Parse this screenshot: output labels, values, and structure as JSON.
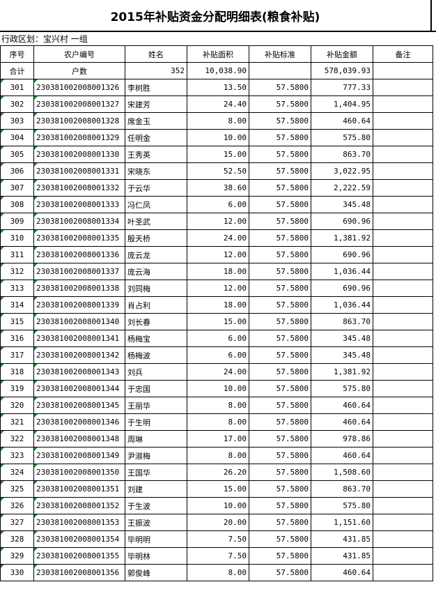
{
  "title": "2015年补贴资金分配明细表(粮食补贴)",
  "region": "行政区划：宝兴村 一组",
  "headers": [
    "序号",
    "农户编号",
    "姓名",
    "补贴面积",
    "补贴标准",
    "补贴金额",
    "备注"
  ],
  "summary": {
    "label": "合计",
    "households_label": "户数",
    "households": "352",
    "area": "10,038.90",
    "standard": "",
    "amount": "578,039.93",
    "note": ""
  },
  "rows": [
    {
      "no": "301",
      "code": "230381002008001326",
      "name": "李树胜",
      "area": "13.50",
      "std": "57.5800",
      "amt": "777.33"
    },
    {
      "no": "302",
      "code": "230381002008001327",
      "name": "宋建芳",
      "area": "24.40",
      "std": "57.5800",
      "amt": "1,404.95"
    },
    {
      "no": "303",
      "code": "230381002008001328",
      "name": "席金玉",
      "area": "8.00",
      "std": "57.5800",
      "amt": "460.64"
    },
    {
      "no": "304",
      "code": "230381002008001329",
      "name": "任明金",
      "area": "10.00",
      "std": "57.5800",
      "amt": "575.80"
    },
    {
      "no": "305",
      "code": "230381002008001330",
      "name": "王秀英",
      "area": "15.00",
      "std": "57.5800",
      "amt": "863.70"
    },
    {
      "no": "306",
      "code": "230381002008001331",
      "name": "宋晓东",
      "area": "52.50",
      "std": "57.5800",
      "amt": "3,022.95"
    },
    {
      "no": "307",
      "code": "230381002008001332",
      "name": "于云华",
      "area": "38.60",
      "std": "57.5800",
      "amt": "2,222.59"
    },
    {
      "no": "308",
      "code": "230381002008001333",
      "name": "冯仁凤",
      "area": "6.00",
      "std": "57.5800",
      "amt": "345.48"
    },
    {
      "no": "309",
      "code": "230381002008001334",
      "name": "叶圣武",
      "area": "12.00",
      "std": "57.5800",
      "amt": "690.96"
    },
    {
      "no": "310",
      "code": "230381002008001335",
      "name": "殷天桥",
      "area": "24.00",
      "std": "57.5800",
      "amt": "1,381.92"
    },
    {
      "no": "311",
      "code": "230381002008001336",
      "name": "庞云龙",
      "area": "12.00",
      "std": "57.5800",
      "amt": "690.96"
    },
    {
      "no": "312",
      "code": "230381002008001337",
      "name": "庞云海",
      "area": "18.00",
      "std": "57.5800",
      "amt": "1,036.44"
    },
    {
      "no": "313",
      "code": "230381002008001338",
      "name": "刘同梅",
      "area": "12.00",
      "std": "57.5800",
      "amt": "690.96"
    },
    {
      "no": "314",
      "code": "230381002008001339",
      "name": "肖占利",
      "area": "18.00",
      "std": "57.5800",
      "amt": "1,036.44"
    },
    {
      "no": "315",
      "code": "230381002008001340",
      "name": "刘长春",
      "area": "15.00",
      "std": "57.5800",
      "amt": "863.70"
    },
    {
      "no": "316",
      "code": "230381002008001341",
      "name": "杨梅宝",
      "area": "6.00",
      "std": "57.5800",
      "amt": "345.48"
    },
    {
      "no": "317",
      "code": "230381002008001342",
      "name": "杨梅波",
      "area": "6.00",
      "std": "57.5800",
      "amt": "345.48"
    },
    {
      "no": "318",
      "code": "230381002008001343",
      "name": "刘兵",
      "area": "24.00",
      "std": "57.5800",
      "amt": "1,381.92"
    },
    {
      "no": "319",
      "code": "230381002008001344",
      "name": "于忠国",
      "area": "10.00",
      "std": "57.5800",
      "amt": "575.80"
    },
    {
      "no": "320",
      "code": "230381002008001345",
      "name": "王丽华",
      "area": "8.00",
      "std": "57.5800",
      "amt": "460.64"
    },
    {
      "no": "321",
      "code": "230381002008001346",
      "name": "于生明",
      "area": "8.00",
      "std": "57.5800",
      "amt": "460.64"
    },
    {
      "no": "322",
      "code": "230381002008001348",
      "name": "周琳",
      "area": "17.00",
      "std": "57.5800",
      "amt": "978.86"
    },
    {
      "no": "323",
      "code": "230381002008001349",
      "name": "尹淑梅",
      "area": "8.00",
      "std": "57.5800",
      "amt": "460.64"
    },
    {
      "no": "324",
      "code": "230381002008001350",
      "name": "王国华",
      "area": "26.20",
      "std": "57.5800",
      "amt": "1,508.60"
    },
    {
      "no": "325",
      "code": "230381002008001351",
      "name": "刘建",
      "area": "15.00",
      "std": "57.5800",
      "amt": "863.70"
    },
    {
      "no": "326",
      "code": "230381002008001352",
      "name": "于生波",
      "area": "10.00",
      "std": "57.5800",
      "amt": "575.80"
    },
    {
      "no": "327",
      "code": "230381002008001353",
      "name": "王振波",
      "area": "20.00",
      "std": "57.5800",
      "amt": "1,151.60"
    },
    {
      "no": "328",
      "code": "230381002008001354",
      "name": "毕明明",
      "area": "7.50",
      "std": "57.5800",
      "amt": "431.85"
    },
    {
      "no": "329",
      "code": "230381002008001355",
      "name": "毕明林",
      "area": "7.50",
      "std": "57.5800",
      "amt": "431.85"
    },
    {
      "no": "330",
      "code": "230381002008001356",
      "name": "郭俊峰",
      "area": "8.00",
      "std": "57.5800",
      "amt": "460.64"
    }
  ],
  "colors": {
    "cell_marker": "#1a8a2a",
    "grid": "#000000"
  }
}
